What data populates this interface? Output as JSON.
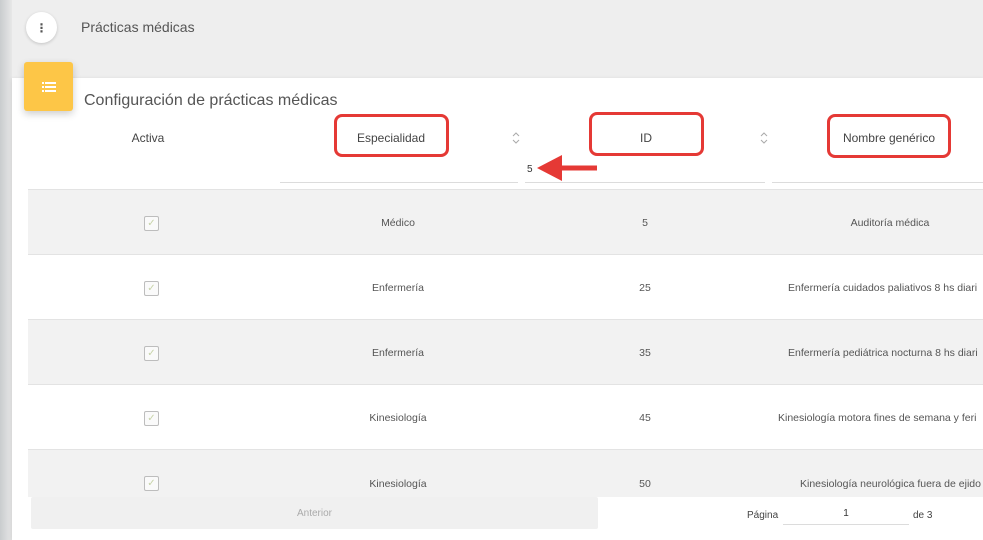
{
  "header": {
    "title": "Prácticas médicas",
    "menu_icon": "vertical-dots-icon"
  },
  "card": {
    "title": "Configuración de prácticas médicas",
    "icon": "list-icon",
    "icon_color": "#fdc647"
  },
  "columns": [
    {
      "label": "Activa"
    },
    {
      "label": "Especialidad"
    },
    {
      "label": "ID"
    },
    {
      "label": "Nombre genérico"
    }
  ],
  "filters": {
    "especialidad": "",
    "id": "5",
    "nombre": ""
  },
  "rows": [
    {
      "especialidad": "Médico",
      "id": "5",
      "nombre": "Auditoría médica"
    },
    {
      "especialidad": "Enfermería",
      "id": "25",
      "nombre": "Enfermería cuidados paliativos 8 hs diari"
    },
    {
      "especialidad": "Enfermería",
      "id": "35",
      "nombre": "Enfermería pediátrica nocturna 8 hs diari"
    },
    {
      "especialidad": "Kinesiología",
      "id": "45",
      "nombre": "Kinesiología motora fines de semana y feri"
    },
    {
      "especialidad": "Kinesiología",
      "id": "50",
      "nombre": "Kinesiología neurológica fuera de ejido"
    }
  ],
  "pagination": {
    "prev_label": "Anterior",
    "page_label": "Página",
    "current_page": "1",
    "of_label": "de 3"
  },
  "colors": {
    "highlight": "#e53935",
    "accent": "#fdc647"
  }
}
